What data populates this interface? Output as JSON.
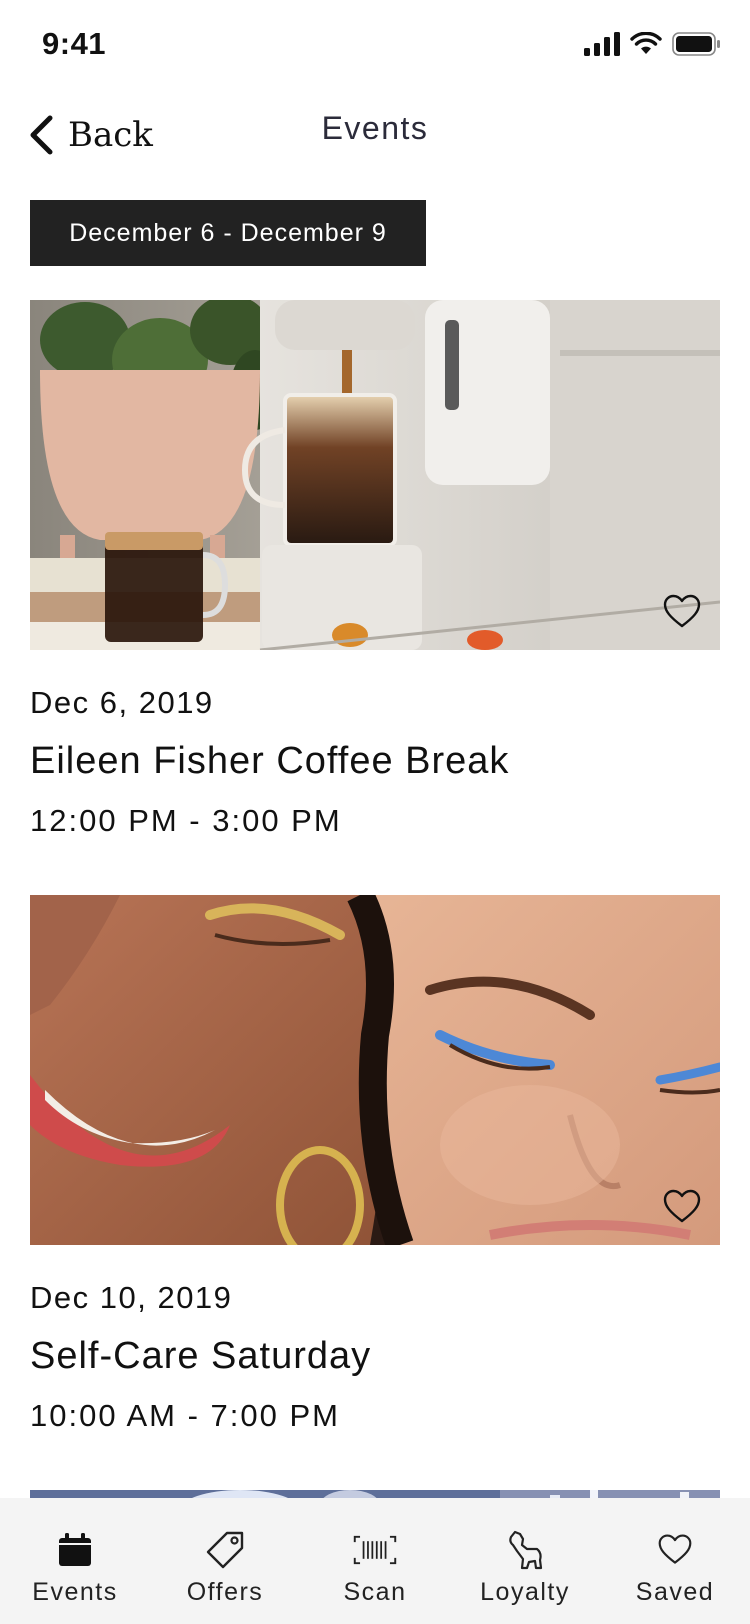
{
  "status_bar": {
    "time": "9:41",
    "icons": [
      "signal-icon",
      "wifi-icon",
      "battery-icon"
    ]
  },
  "nav": {
    "back_label": "Back",
    "title": "Events"
  },
  "date_range": "December 6 - December 9",
  "events": [
    {
      "date": "Dec 6, 2019",
      "title": "Eileen Fisher Coffee Break",
      "time": "12:00 PM - 3:00 PM",
      "image": "coffee-machine-photo",
      "favorite_icon": "heart-outline-icon"
    },
    {
      "date": "Dec 10, 2019",
      "title": "Self-Care Saturday",
      "time": "10:00 AM - 7:00 PM",
      "image": "glitter-makeup-photo",
      "favorite_icon": "heart-outline-icon"
    }
  ],
  "tabs": [
    {
      "label": "Events",
      "icon": "calendar-icon",
      "active": true
    },
    {
      "label": "Offers",
      "icon": "tag-icon",
      "active": false
    },
    {
      "label": "Scan",
      "icon": "barcode-icon",
      "active": false
    },
    {
      "label": "Loyalty",
      "icon": "dog-icon",
      "active": false
    },
    {
      "label": "Saved",
      "icon": "heart-icon",
      "active": false
    }
  ],
  "colors": {
    "date_chip_bg": "#222222",
    "tab_bar_bg": "#f4f4f4",
    "text": "#111111"
  }
}
